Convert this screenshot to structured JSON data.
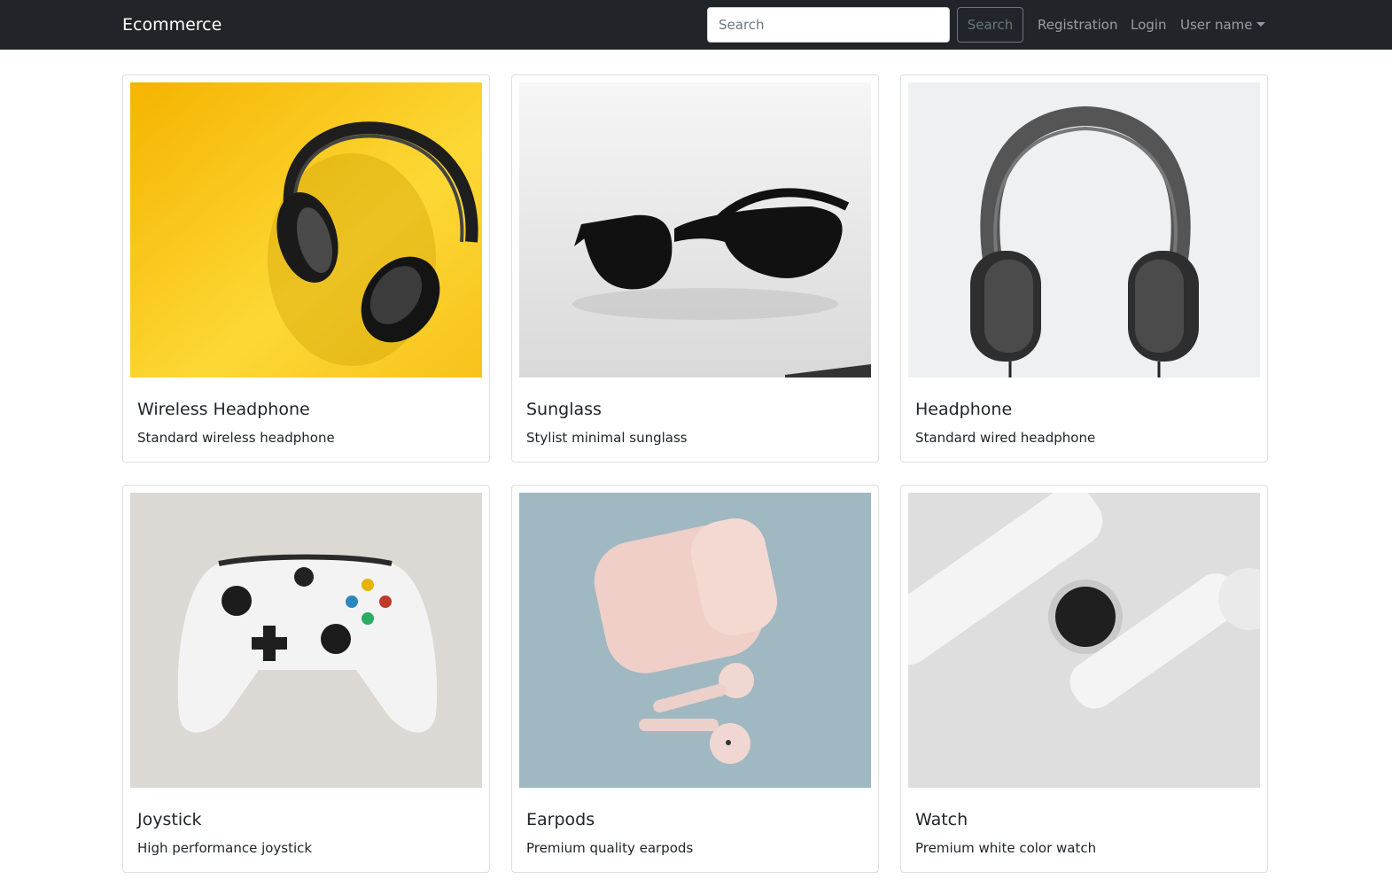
{
  "navbar": {
    "brand": "Ecommerce",
    "search_placeholder": "Search",
    "search_button": "Search",
    "links": {
      "registration": "Registration",
      "login": "Login",
      "user": "User name"
    }
  },
  "products": [
    {
      "title": "Wireless Headphone",
      "description": "Standard wireless headphone"
    },
    {
      "title": "Sunglass",
      "description": "Stylist minimal sunglass"
    },
    {
      "title": "Headphone",
      "description": "Standard wired headphone"
    },
    {
      "title": "Joystick",
      "description": "High performance joystick"
    },
    {
      "title": "Earpods",
      "description": "Premium quality earpods"
    },
    {
      "title": "Watch",
      "description": "Premium white color watch"
    }
  ],
  "colors": {
    "navbar_bg": "#212529",
    "brand_text": "#ffffff",
    "nav_link": "rgba(255,255,255,0.55)",
    "outline_button": "#6c757d"
  }
}
